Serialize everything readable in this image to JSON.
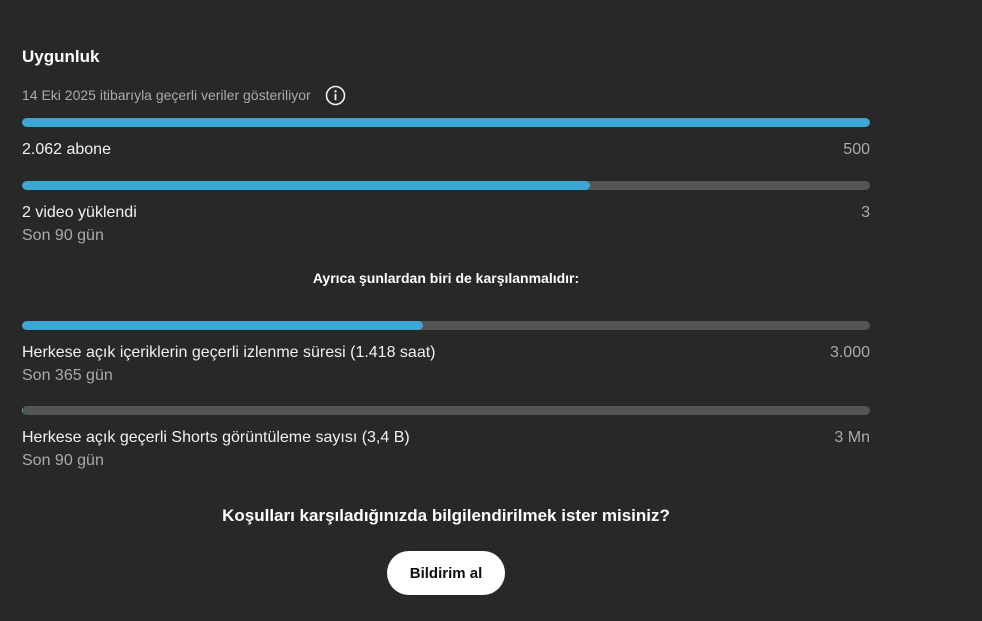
{
  "eligibility": {
    "title": "Uygunluk",
    "subtitle": "14 Eki 2025 itibarıyla geçerli veriler gösteriliyor",
    "info_icon": "info-circle-icon"
  },
  "requirements": [
    {
      "label": "2.062 abone",
      "target": "500",
      "period": "",
      "progress": 1.0
    },
    {
      "label": "2 video yüklendi",
      "target": "3",
      "period": "Son 90 gün",
      "progress": 0.67
    }
  ],
  "also_required_heading": "Ayrıca şunlardan biri de karşılanmalıdır:",
  "alternatives": [
    {
      "label": "Herkese açık içeriklerin geçerli izlenme süresi (1.418 saat)",
      "target": "3.000",
      "period": "Son 365 gün",
      "progress": 0.473
    },
    {
      "label": "Herkese açık geçerli Shorts görüntüleme sayısı (3,4 B)",
      "target": "3 Mn",
      "period": "Son 90 gün",
      "progress": 0.0011
    }
  ],
  "notify": {
    "question": "Koşulları karşıladığınızda bilgilendirilmek ister misiniz?",
    "button_label": "Bildirim al"
  },
  "colors": {
    "background": "#282828",
    "bar_track": "#555555",
    "bar_fill": "#3ea6d4",
    "button_bg": "#ffffff"
  }
}
